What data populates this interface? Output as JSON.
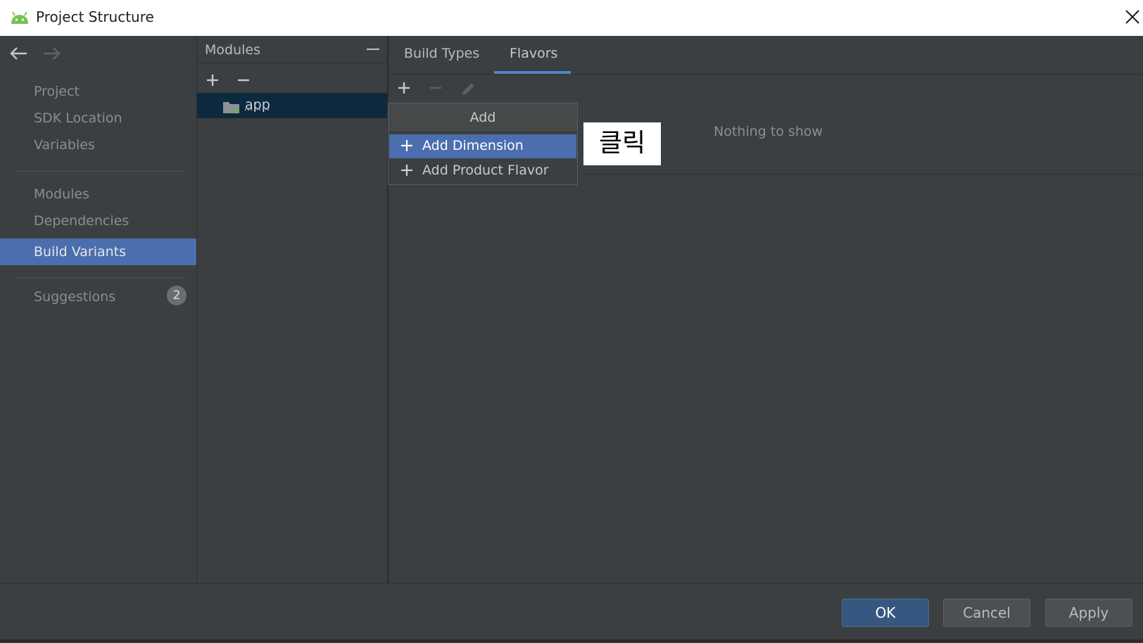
{
  "window": {
    "title": "Project Structure"
  },
  "sidebar": {
    "items": [
      {
        "label": "Project"
      },
      {
        "label": "SDK Location"
      },
      {
        "label": "Variables"
      },
      {
        "label": "Modules"
      },
      {
        "label": "Dependencies"
      },
      {
        "label": "Build Variants",
        "selected": true
      },
      {
        "label": "Suggestions",
        "badge": "2"
      }
    ]
  },
  "modules": {
    "title": "Modules",
    "items": [
      {
        "label": "app"
      }
    ]
  },
  "tabs": [
    {
      "label": "Build Types"
    },
    {
      "label": "Flavors",
      "active": true
    }
  ],
  "content": {
    "empty_text": "Nothing to show"
  },
  "popup": {
    "title": "Add",
    "items": [
      {
        "label": "Add Dimension",
        "active": true
      },
      {
        "label": "Add Product Flavor"
      }
    ]
  },
  "callout": {
    "text": "클릭"
  },
  "footer": {
    "ok": "OK",
    "cancel": "Cancel",
    "apply": "Apply"
  },
  "colors": {
    "accent": "#4b6eaf",
    "tab_underline": "#4a88c7",
    "background": "#3c3f41",
    "android_green": "#78c257"
  },
  "icons": [
    "android-icon",
    "close-icon",
    "back-arrow-icon",
    "forward-arrow-icon",
    "plus-icon",
    "minus-icon",
    "edit-pencil-icon",
    "folder-icon"
  ]
}
